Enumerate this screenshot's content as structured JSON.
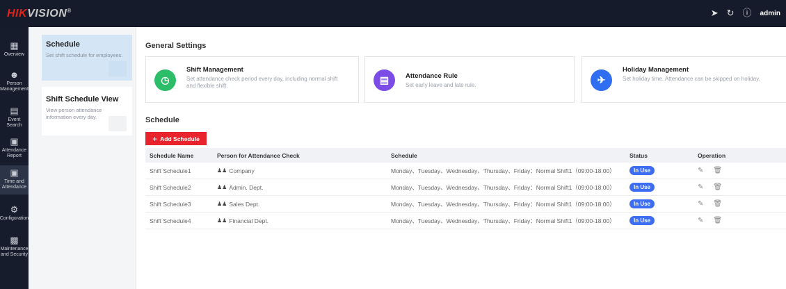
{
  "brand": {
    "logo_red": "HIK",
    "logo_rest": "VISION",
    "logo_mark": "®"
  },
  "topbar": {
    "icons": [
      "send-icon",
      "sync-icon",
      "info-icon"
    ],
    "user": "admin"
  },
  "rail": {
    "items": [
      {
        "id": "overview",
        "label": "Overview",
        "icon": "chart-icon"
      },
      {
        "id": "person",
        "label": "Person Management",
        "icon": "person-icon"
      },
      {
        "id": "event",
        "label": "Event Search",
        "icon": "search-doc-icon"
      },
      {
        "id": "report",
        "label": "Attendance Report",
        "icon": "report-icon"
      },
      {
        "id": "time",
        "label": "Time and Attendance",
        "icon": "calendar-icon",
        "active": true
      },
      {
        "id": "config",
        "label": "Configuration",
        "icon": "gear-icon"
      },
      {
        "id": "maint",
        "label": "Maintenance and Security",
        "icon": "shield-icon"
      }
    ]
  },
  "subnav": {
    "items": [
      {
        "title": "Schedule",
        "desc": "Set shift schedule for employees.",
        "active": true
      },
      {
        "title": "Shift Schedule View",
        "desc": "View person attendance information every day."
      }
    ]
  },
  "general": {
    "title": "General Settings",
    "cards": [
      {
        "title": "Shift Management",
        "desc": "Set attendance check period every day, including normal shift and flexible shift.",
        "color": "#2bbd67",
        "icon": "clock-icon"
      },
      {
        "title": "Attendance Rule",
        "desc": "Set early leave and late rule.",
        "color": "#7b4de6",
        "icon": "clipboard-icon"
      },
      {
        "title": "Holiday Management",
        "desc": "Set holiday time. Attendance can be skipped on holiday.",
        "color": "#2f6ef0",
        "icon": "plane-icon"
      }
    ]
  },
  "schedule": {
    "title": "Schedule",
    "add_label": "Add Schedule",
    "columns": [
      "Schedule Name",
      "Person for Attendance Check",
      "Schedule",
      "Status",
      "Operation"
    ],
    "rows": [
      {
        "name": "Shift Schedule1",
        "person": "Company",
        "schedule": "Monday、Tuesday、Wednesday、Thursday、Friday：Normal Shift1（09:00-18:00）",
        "status": "In Use"
      },
      {
        "name": "Shift Schedule2",
        "person": "Admin. Dept.",
        "schedule": "Monday、Tuesday、Wednesday、Thursday、Friday：Normal Shift1（09:00-18:00）",
        "status": "In Use"
      },
      {
        "name": "Shift Schedule3",
        "person": "Sales Dept.",
        "schedule": "Monday、Tuesday、Wednesday、Thursday、Friday：Normal Shift1（09:00-18:00）",
        "status": "In Use"
      },
      {
        "name": "Shift Schedule4",
        "person": "Financial Dept.",
        "schedule": "Monday、Tuesday、Wednesday、Thursday、Friday：Normal Shift1（09:00-18:00）",
        "status": "In Use"
      }
    ]
  }
}
